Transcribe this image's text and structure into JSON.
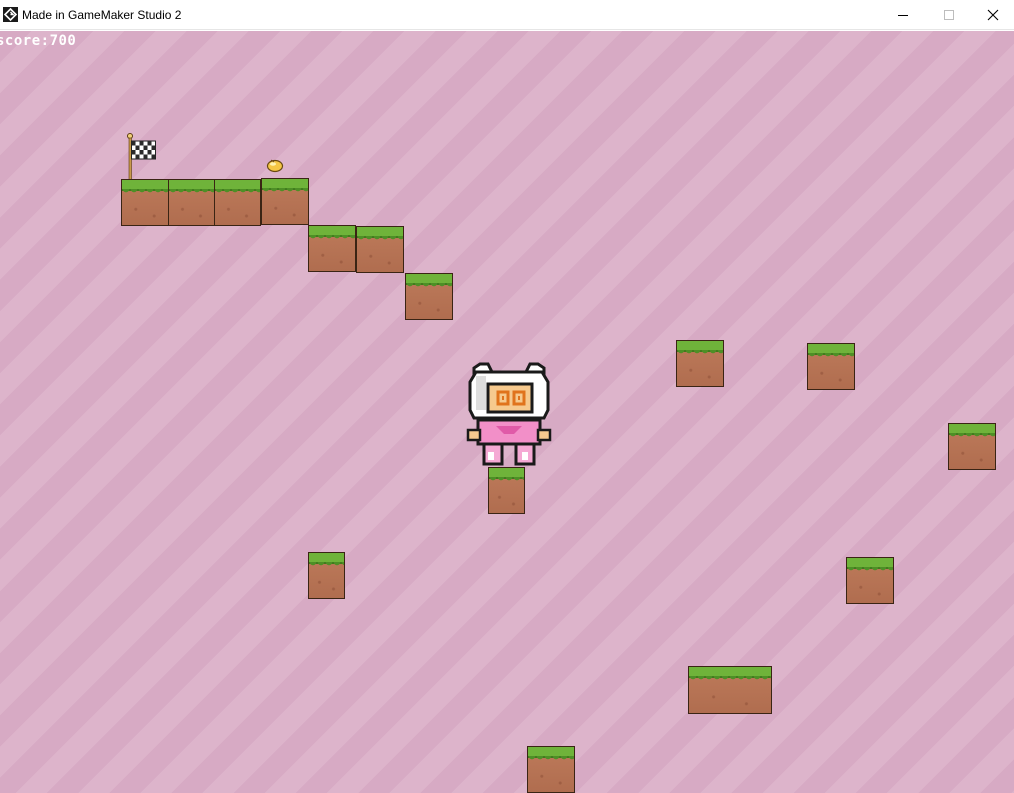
{
  "window": {
    "title": "Made in GameMaker Studio 2",
    "icon": "gamemaker-logo-icon",
    "controls": [
      "minimize-icon",
      "maximize-icon",
      "close-icon"
    ]
  },
  "hud": {
    "score_text": "score:700"
  },
  "colors": {
    "sky_stripe_a": "#d7aac4",
    "sky_stripe_b": "#ddb4cb",
    "grass": "#6fb33a",
    "dirt": "#b8755a",
    "player_pink": "#f28fc8",
    "hood": "#ffffff"
  },
  "sprites": {
    "goal": "checkered-flag-icon",
    "pickup": "gold-coin-icon",
    "player": "white-cat-hood-character"
  }
}
